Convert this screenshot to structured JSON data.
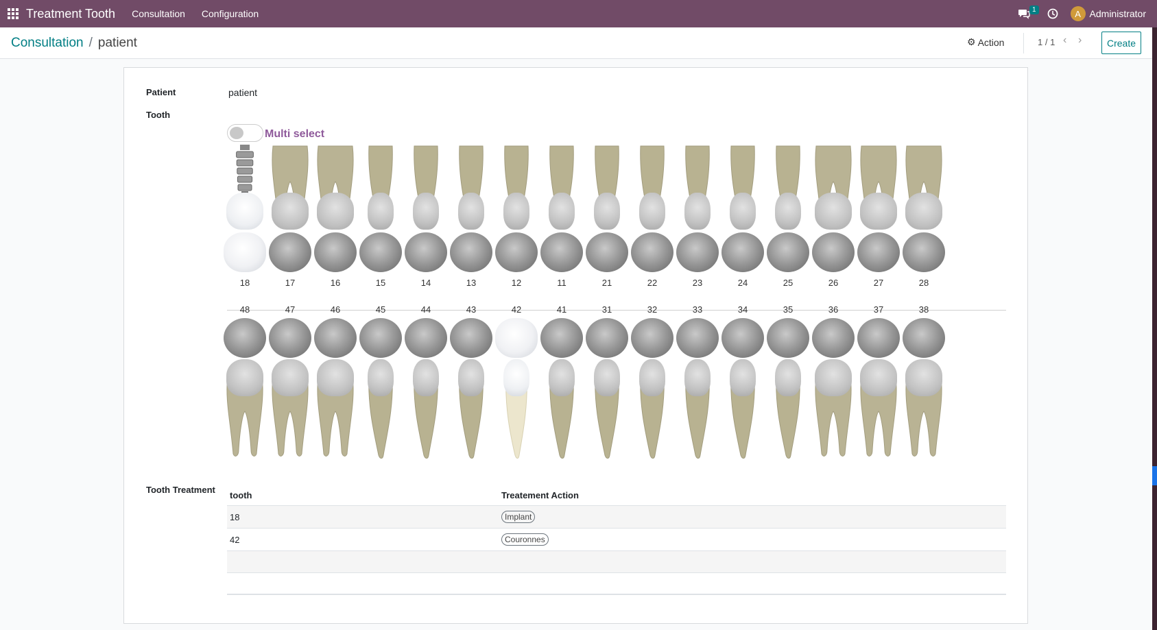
{
  "navbar": {
    "app_name": "Treatment Tooth",
    "menu": [
      "Consultation",
      "Configuration"
    ],
    "chat_badge": "1",
    "avatar_letter": "A",
    "user": "Administrator",
    "color": "#714b67"
  },
  "control_panel": {
    "breadcrumb_parent": "Consultation",
    "breadcrumb_separator": "/",
    "breadcrumb_current": "patient",
    "action_label": "Action",
    "pager": "1 / 1",
    "create_label": "Create",
    "accent_color": "#017e84"
  },
  "form": {
    "patient_label": "Patient",
    "patient_value": "patient",
    "tooth_label": "Tooth",
    "multi_select_label": "Multi select",
    "multi_select_on": false,
    "tooth_treatment_label": "Tooth Treatment"
  },
  "teeth": {
    "upper": [
      {
        "num": "18",
        "state": "implant"
      },
      {
        "num": "17",
        "state": "normal"
      },
      {
        "num": "16",
        "state": "normal"
      },
      {
        "num": "15",
        "state": "normal"
      },
      {
        "num": "14",
        "state": "normal"
      },
      {
        "num": "13",
        "state": "normal"
      },
      {
        "num": "12",
        "state": "normal"
      },
      {
        "num": "11",
        "state": "normal"
      },
      {
        "num": "21",
        "state": "normal"
      },
      {
        "num": "22",
        "state": "normal"
      },
      {
        "num": "23",
        "state": "normal"
      },
      {
        "num": "24",
        "state": "normal"
      },
      {
        "num": "25",
        "state": "normal"
      },
      {
        "num": "26",
        "state": "normal"
      },
      {
        "num": "27",
        "state": "normal"
      },
      {
        "num": "28",
        "state": "normal"
      }
    ],
    "lower": [
      {
        "num": "48",
        "state": "normal"
      },
      {
        "num": "47",
        "state": "normal"
      },
      {
        "num": "46",
        "state": "normal"
      },
      {
        "num": "45",
        "state": "normal"
      },
      {
        "num": "44",
        "state": "normal"
      },
      {
        "num": "43",
        "state": "normal"
      },
      {
        "num": "42",
        "state": "crown"
      },
      {
        "num": "41",
        "state": "normal"
      },
      {
        "num": "31",
        "state": "normal"
      },
      {
        "num": "32",
        "state": "normal"
      },
      {
        "num": "33",
        "state": "normal"
      },
      {
        "num": "34",
        "state": "normal"
      },
      {
        "num": "35",
        "state": "normal"
      },
      {
        "num": "36",
        "state": "normal"
      },
      {
        "num": "37",
        "state": "normal"
      },
      {
        "num": "38",
        "state": "normal"
      }
    ]
  },
  "treatment_table": {
    "columns": [
      "tooth",
      "Treatement Action"
    ],
    "rows": [
      {
        "tooth": "18",
        "action": "Implant"
      },
      {
        "tooth": "42",
        "action": "Couronnes"
      }
    ]
  }
}
